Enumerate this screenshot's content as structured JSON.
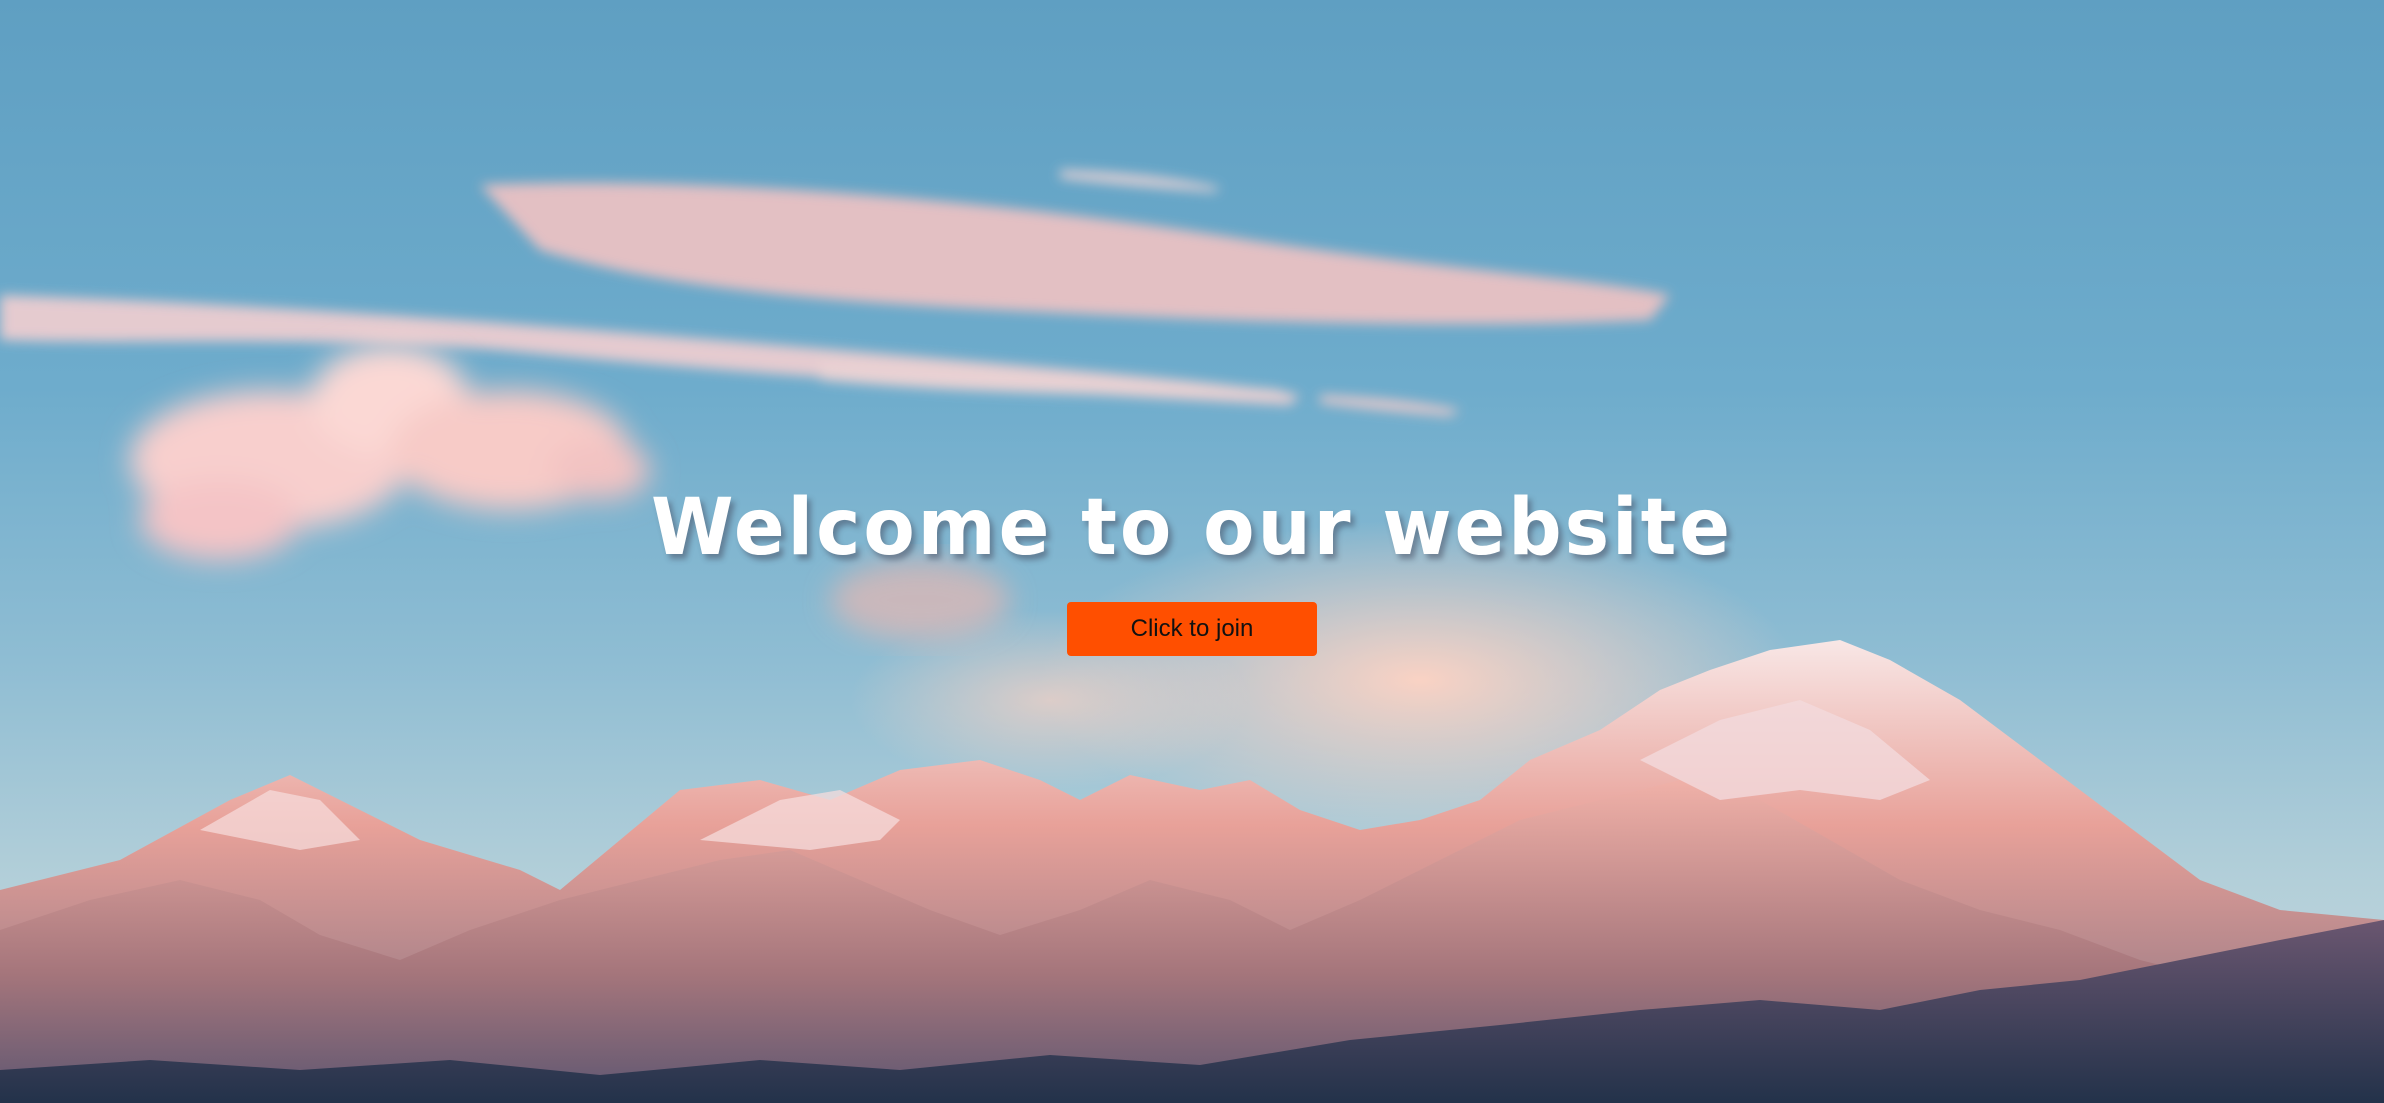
{
  "hero": {
    "headline": "Welcome to our website",
    "cta_label": "Click to join",
    "background": "mountain-range-sunset-photo"
  },
  "colors": {
    "sky_top": "#5f9fc2",
    "sky_bottom": "#c9d8de",
    "cloud_pink": "#f6c8c4",
    "button": "#ff4f00",
    "headline": "#ffffff"
  }
}
